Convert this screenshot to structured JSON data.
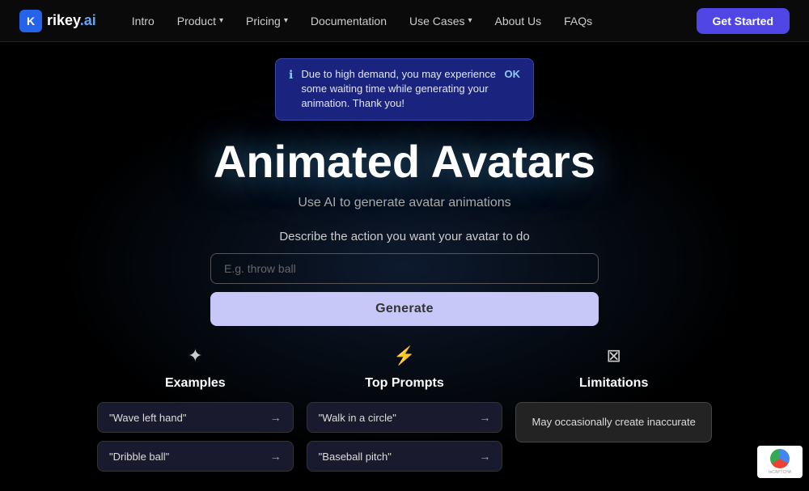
{
  "nav": {
    "logo_k": "K",
    "logo_name_main": "rikey",
    "logo_name_accent": ".ai",
    "links": [
      {
        "label": "Intro",
        "has_dropdown": false
      },
      {
        "label": "Product",
        "has_dropdown": true
      },
      {
        "label": "Pricing",
        "has_dropdown": true
      },
      {
        "label": "Documentation",
        "has_dropdown": false
      },
      {
        "label": "Use Cases",
        "has_dropdown": true
      },
      {
        "label": "About Us",
        "has_dropdown": false
      },
      {
        "label": "FAQs",
        "has_dropdown": false
      }
    ],
    "cta_label": "Get Started"
  },
  "notification": {
    "text": "Due to high demand, you may experience some waiting time while generating your animation. Thank you!",
    "ok_label": "OK"
  },
  "hero": {
    "title": "Animated Avatars",
    "subtitle": "Use AI to generate avatar animations",
    "prompt_label": "Describe the action you want your avatar to do",
    "input_placeholder": "E.g. throw ball",
    "generate_label": "Generate"
  },
  "sections": [
    {
      "id": "examples",
      "icon": "☀",
      "title": "Examples",
      "cards": [
        {
          "text": "\"Wave left hand\"",
          "arrow": "→"
        },
        {
          "text": "\"Dribble ball\"",
          "arrow": "→"
        }
      ]
    },
    {
      "id": "top_prompts",
      "icon": "⚡",
      "title": "Top Prompts",
      "cards": [
        {
          "text": "\"Walk in a circle\"",
          "arrow": "→"
        },
        {
          "text": "\"Baseball pitch\"",
          "arrow": "→"
        }
      ]
    },
    {
      "id": "limitations",
      "icon": "⛶",
      "title": "Limitations",
      "cards": [
        {
          "text": "May occasionally create inaccurate"
        }
      ]
    }
  ]
}
